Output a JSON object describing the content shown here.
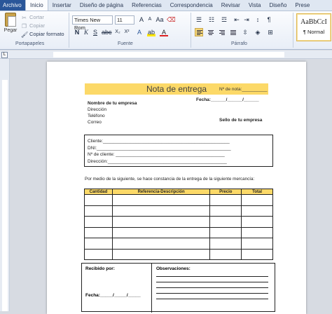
{
  "tabs": [
    "Archivo",
    "Inicio",
    "Insertar",
    "Diseño de página",
    "Referencias",
    "Correspondencia",
    "Revisar",
    "Vista",
    "Diseño",
    "Prese"
  ],
  "active_tab": "Inicio",
  "clipboard": {
    "paste_label": "Pegar",
    "items": [
      {
        "icon": "scissors-icon",
        "label": "Cortar"
      },
      {
        "icon": "copy-icon",
        "label": "Copiar"
      },
      {
        "icon": "format-painter-icon",
        "label": "Copiar formato"
      }
    ],
    "group_label": "Portapapeles"
  },
  "font": {
    "family": "Times New Rom",
    "size": "11",
    "group_label": "Fuente"
  },
  "paragraph": {
    "group_label": "Párrafo"
  },
  "styles": {
    "preview": "AaBbCcI",
    "name": "¶ Normal"
  },
  "document": {
    "title": "Nota de entrega",
    "note_number": "Nº de nota:__________",
    "date_line": "Fecha:______/______/______",
    "company_lines": [
      "Nombre de tu empresa",
      "Dirección",
      "Teléfono",
      "Correo"
    ],
    "stamp": "Sello de tu empresa",
    "client_lines": [
      "Cliente:__________________________________________________",
      "DNI:_____________________________________________________",
      "Nº de cliente: ___________________________________________",
      "Dirección:_______________________________________________"
    ],
    "intro": "Por medio de la siguiente, se hace constancia de la entrega de la siguiente mercancía:",
    "table_headers": [
      "Cantidad",
      "Referencia-Descripción",
      "Precio",
      "Total"
    ],
    "row_count": 6,
    "received": "Recibido por:",
    "received_date": "Fecha:_____/_____/_____",
    "observations": "Observaciones:"
  },
  "colors": {
    "accent": "#fcd968",
    "file_tab": "#2a5699"
  }
}
